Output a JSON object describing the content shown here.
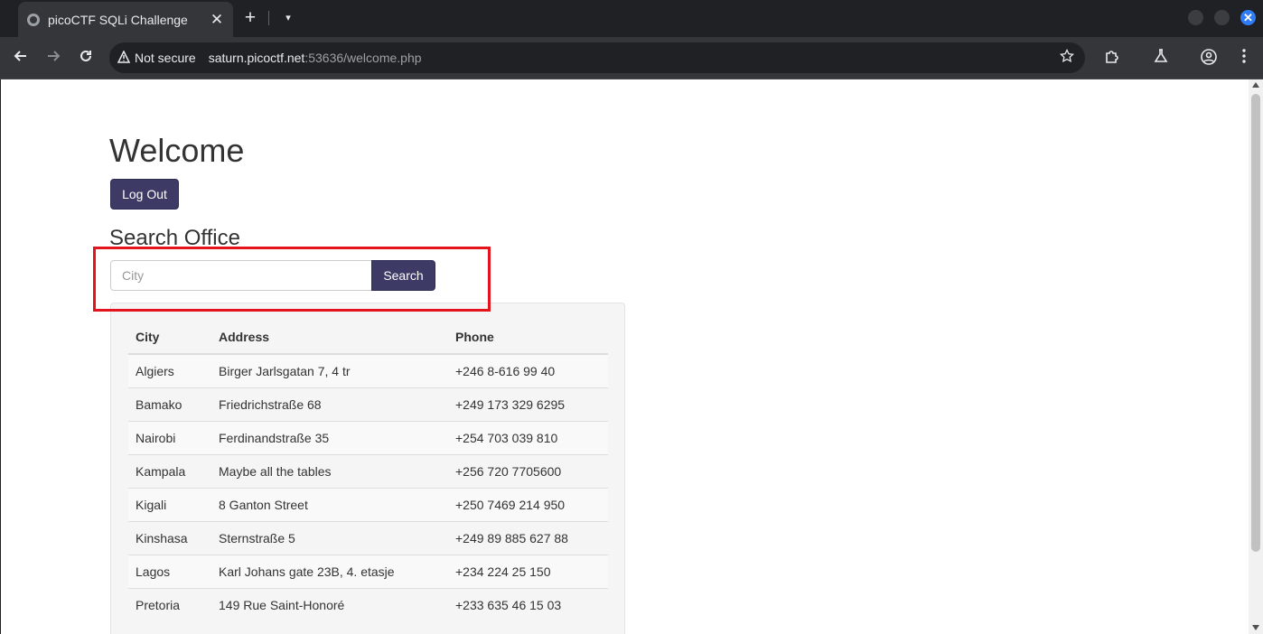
{
  "browser": {
    "tab_title": "picoCTF SQLi Challenge",
    "tab_close": "✕",
    "new_tab": "+",
    "tab_search": "▾",
    "security_label": "Not secure",
    "url_host": "saturn.picoctf.net",
    "url_rest": ":53636/welcome.php",
    "window_close": "✕",
    "icons": [
      "back-icon",
      "forward-icon",
      "reload-icon",
      "warning-icon",
      "star-icon",
      "extensions-icon",
      "labs-icon",
      "profile-icon"
    ]
  },
  "page": {
    "title": "Welcome",
    "logout_label": "Log Out",
    "section_title": "Search Office",
    "search": {
      "placeholder": "City",
      "button_label": "Search"
    },
    "table": {
      "headers": [
        "City",
        "Address",
        "Phone"
      ],
      "rows": [
        [
          "Algiers",
          "Birger Jarlsgatan 7, 4 tr",
          "+246 8-616 99 40"
        ],
        [
          "Bamako",
          "Friedrichstraße 68",
          "+249 173 329 6295"
        ],
        [
          "Nairobi",
          "Ferdinandstraße 35",
          "+254 703 039 810"
        ],
        [
          "Kampala",
          "Maybe all the tables",
          "+256 720 7705600"
        ],
        [
          "Kigali",
          "8 Ganton Street",
          "+250 7469 214 950"
        ],
        [
          "Kinshasa",
          "Sternstraße 5",
          "+249 89 885 627 88"
        ],
        [
          "Lagos",
          "Karl Johans gate 23B, 4. etasje",
          "+234 224 25 150"
        ],
        [
          "Pretoria",
          "149 Rue Saint-Honoré",
          "+233 635 46 15 03"
        ]
      ]
    }
  },
  "colors": {
    "button_bg": "#3d3b66",
    "highlight": "#e3141c",
    "chrome_dark": "#202124",
    "chrome_toolbar": "#35363a"
  }
}
